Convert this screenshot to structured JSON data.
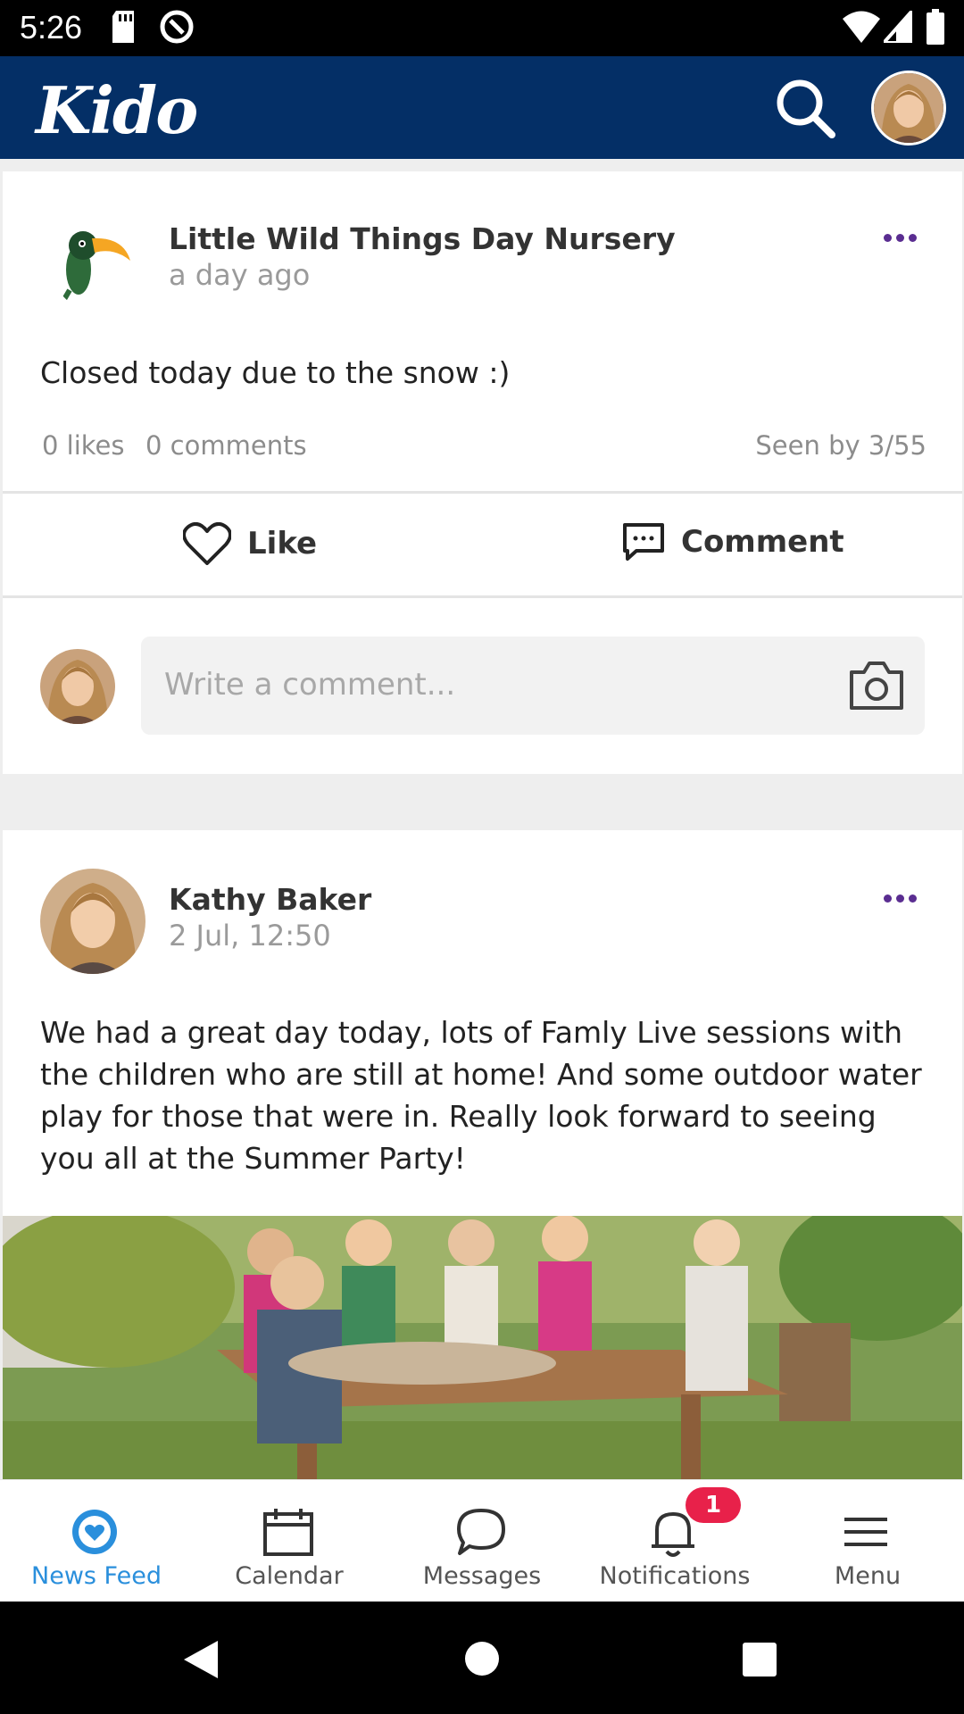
{
  "status_bar": {
    "time": "5:26"
  },
  "app_bar": {
    "logo": "Kido"
  },
  "posts": [
    {
      "author": "Little Wild Things Day Nursery",
      "time": "a day ago",
      "text": "Closed today due to the snow :)",
      "likes": "0 likes",
      "comments": "0 comments",
      "seen": "Seen by 3/55",
      "like_label": "Like",
      "comment_label": "Comment",
      "comment_placeholder": "Write a comment..."
    },
    {
      "author": "Kathy Baker",
      "time": "2 Jul, 12:50",
      "text": "We had a great day today, lots of Famly Live sessions with the children who are still at home! And some outdoor water play for those that were in. Really look forward to seeing you all at the Summer Party!"
    }
  ],
  "tabs": [
    {
      "label": "News Feed",
      "icon": "news-feed-icon",
      "active": true
    },
    {
      "label": "Calendar",
      "icon": "calendar-icon"
    },
    {
      "label": "Messages",
      "icon": "messages-icon"
    },
    {
      "label": "Notifications",
      "icon": "bell-icon",
      "badge": "1"
    },
    {
      "label": "Menu",
      "icon": "menu-icon"
    }
  ],
  "colors": {
    "app_bar": "#042f66",
    "accent": "#2a8fdc",
    "badge": "#e8214a",
    "more_dots": "#5a2d91"
  }
}
